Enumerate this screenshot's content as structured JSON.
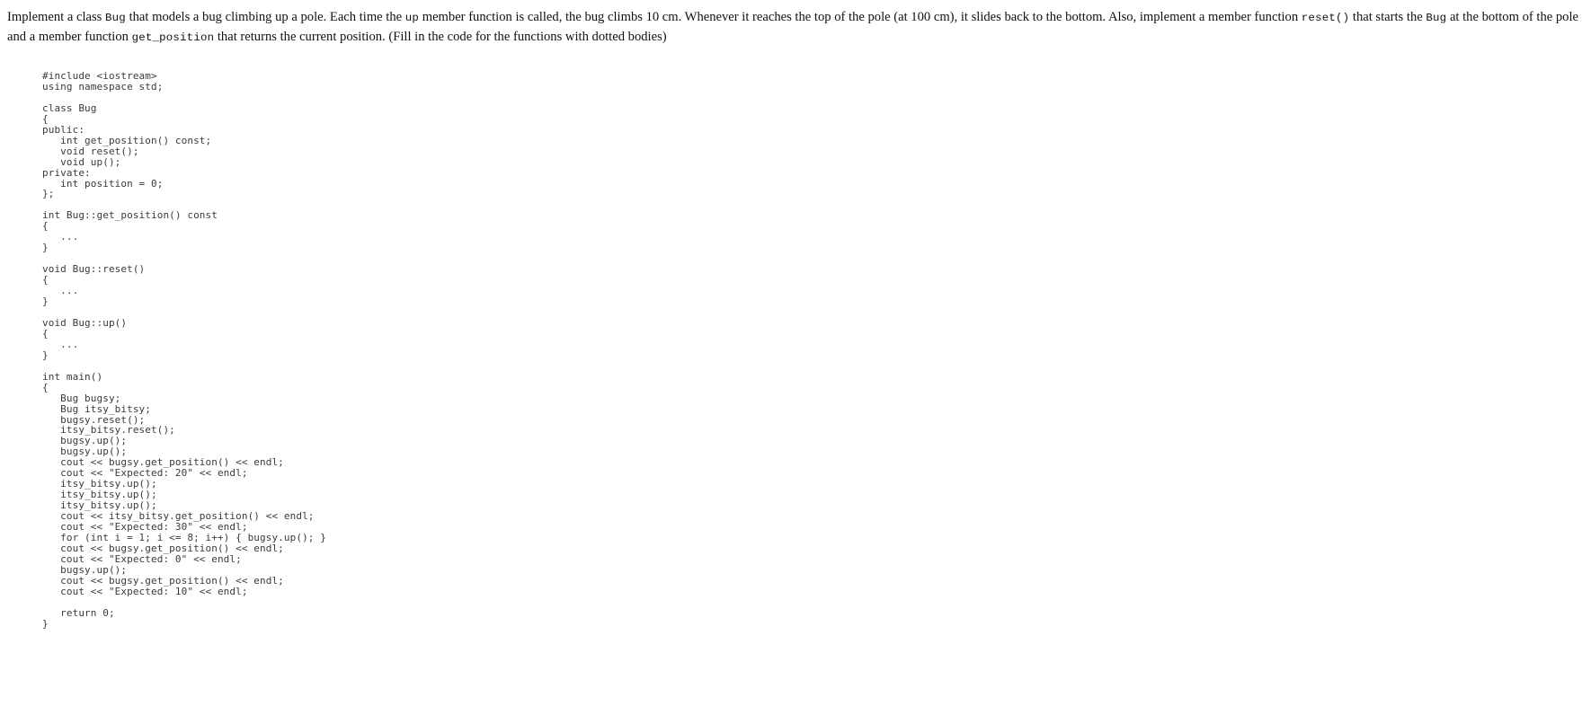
{
  "document": {
    "kind": "programming-exercise",
    "language": "C++",
    "background_color": "#ffffff",
    "text_color": "#111111",
    "code_text_color": "#3a3a3a"
  },
  "problem_statement": {
    "segments": [
      {
        "type": "text",
        "value": "Implement a class "
      },
      {
        "type": "code",
        "value": "Bug"
      },
      {
        "type": "text",
        "value": " that models a bug climbing up a pole. Each time the "
      },
      {
        "type": "code",
        "value": "up"
      },
      {
        "type": "text",
        "value": " member function is called, the bug climbs 10 cm. Whenever it reaches the top of the pole (at 100 cm), it slides back to the bottom. Also, implement a member function "
      },
      {
        "type": "code",
        "value": "reset()"
      },
      {
        "type": "text",
        "value": " that starts the "
      },
      {
        "type": "code",
        "value": "Bug"
      },
      {
        "type": "text",
        "value": " at the bottom of the pole and a member function "
      },
      {
        "type": "code",
        "value": "get_position"
      },
      {
        "type": "text",
        "value": " that returns the current position. (Fill in the code for the functions with dotted bodies)"
      }
    ]
  },
  "code_listing": {
    "lines": [
      "#include <iostream>",
      "using namespace std;",
      "",
      "class Bug",
      "{",
      "public:",
      "   int get_position() const;",
      "   void reset();",
      "   void up();",
      "private:",
      "   int position = 0;",
      "};",
      "",
      "int Bug::get_position() const",
      "{",
      "   ...",
      "}",
      "",
      "void Bug::reset()",
      "{",
      "   ...",
      "}",
      "",
      "void Bug::up()",
      "{",
      "   ...",
      "}",
      "",
      "int main()",
      "{",
      "   Bug bugsy;",
      "   Bug itsy_bitsy;",
      "   bugsy.reset();",
      "   itsy_bitsy.reset();",
      "   bugsy.up();",
      "   bugsy.up();",
      "   cout << bugsy.get_position() << endl;",
      "   cout << \"Expected: 20\" << endl;",
      "   itsy_bitsy.up();",
      "   itsy_bitsy.up();",
      "   itsy_bitsy.up();",
      "   cout << itsy_bitsy.get_position() << endl;",
      "   cout << \"Expected: 30\" << endl;",
      "   for (int i = 1; i <= 8; i++) { bugsy.up(); }",
      "   cout << bugsy.get_position() << endl;",
      "   cout << \"Expected: 0\" << endl;",
      "   bugsy.up();",
      "   cout << bugsy.get_position() << endl;",
      "   cout << \"Expected: 10\" << endl;",
      "",
      "   return 0;",
      "}"
    ]
  }
}
